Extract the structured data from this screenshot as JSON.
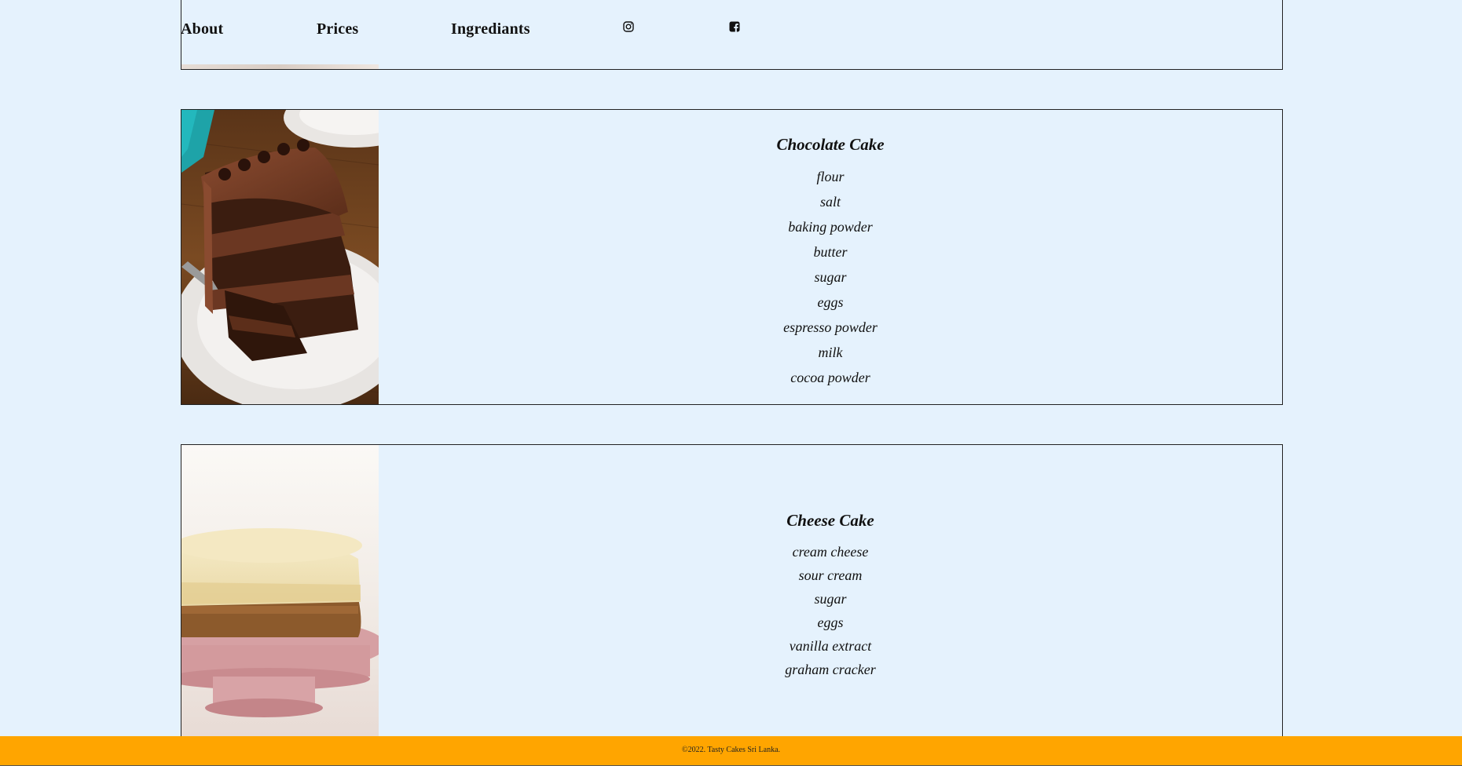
{
  "nav": {
    "links": [
      "About",
      "Prices",
      "Ingrediants"
    ],
    "social_icons": [
      "instagram-icon",
      "facebook-icon"
    ]
  },
  "cakes": [
    {
      "name": "Chocolate Cake",
      "ingredients": [
        "flour",
        "salt",
        "baking powder",
        "butter",
        "sugar",
        "eggs",
        "espresso powder",
        "milk",
        "cocoa powder"
      ]
    },
    {
      "name": "Cheese Cake",
      "ingredients": [
        "cream cheese",
        "sour cream",
        "sugar",
        "eggs",
        "vanilla extract",
        "graham cracker"
      ]
    }
  ],
  "footer": {
    "text": "©2022. Tasty Cakes Sri Lanka."
  },
  "colors": {
    "background": "#e5f2fd",
    "footer": "#ffa500",
    "border": "#222222"
  }
}
